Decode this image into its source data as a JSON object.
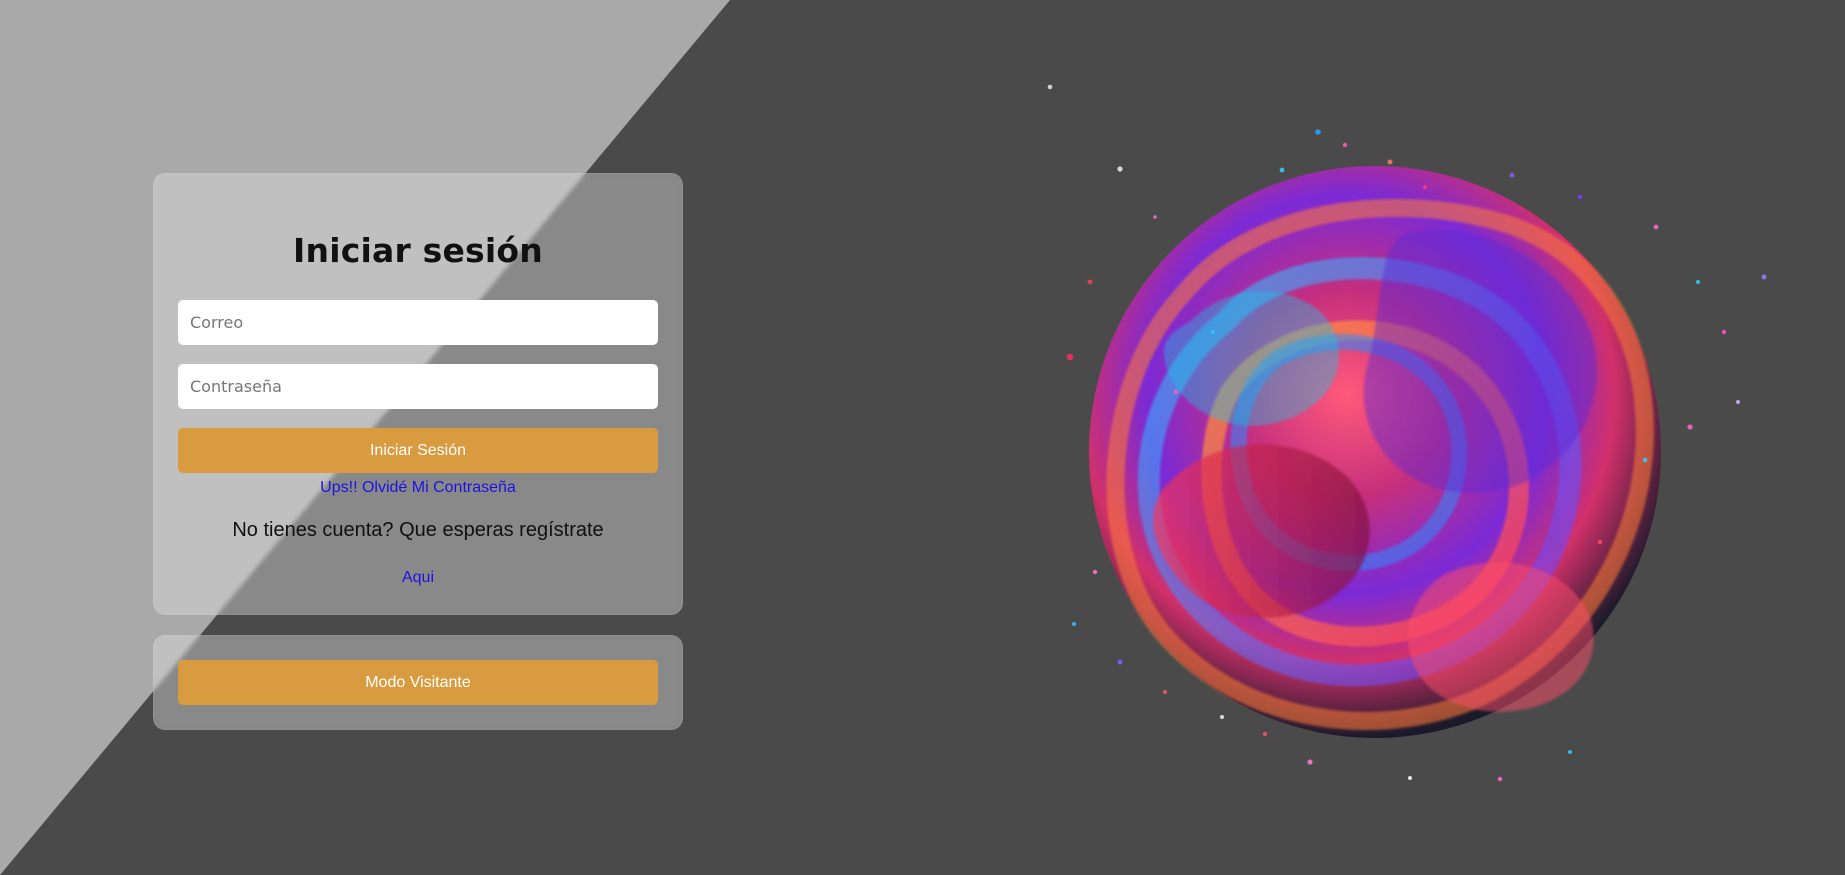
{
  "login": {
    "title": "Iniciar sesión",
    "email_placeholder": "Correo",
    "password_placeholder": "Contraseña",
    "submit_label": "Iniciar Sesión",
    "forgot_link": "Ups!! Olvidé Mi Contraseña",
    "register_prompt": "No tienes cuenta? Que esperas regístrate",
    "register_link": "Aqui"
  },
  "visitor": {
    "button_label": "Modo Visitante"
  },
  "colors": {
    "background": "#4a4a4a",
    "diagonal_band": "#a9a9a9",
    "accent_button": "#d99b40",
    "link": "#1b14e0"
  },
  "icons": {
    "hero_art": "abstract-fluid-sphere-icon"
  }
}
